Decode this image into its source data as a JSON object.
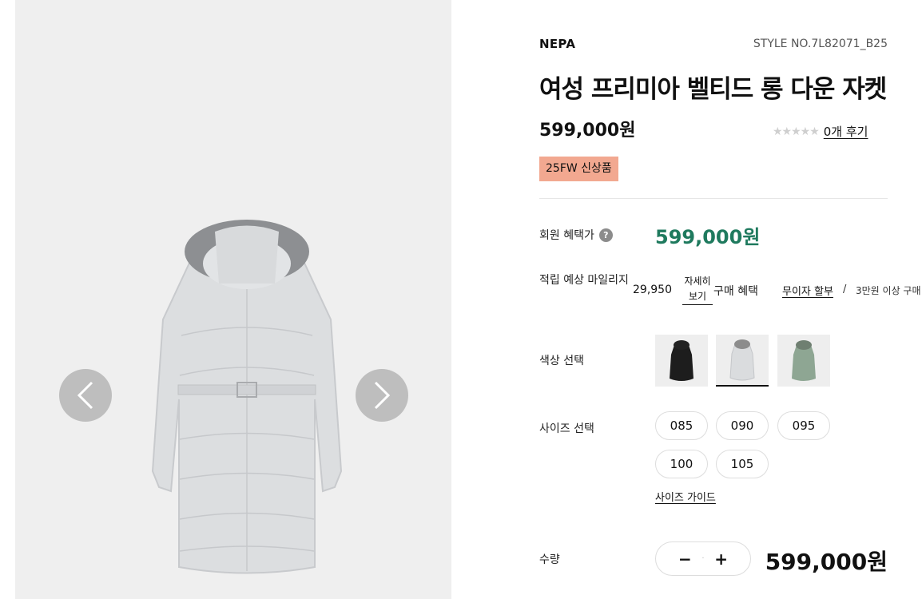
{
  "product": {
    "brand": "NEPA",
    "style_no": "STYLE NO.7L82071_B25",
    "title": "여성 프리미아 벨티드 롱 다운 자켓",
    "price": "599,000원",
    "rating": {
      "stars": "★★★★★",
      "filled": 0,
      "review_link": "0개 후기"
    },
    "badge": "25FW 신상품"
  },
  "benefits": {
    "member_label": "회원 혜택가",
    "help_icon": "?",
    "member_price": "599,000원",
    "mileage_label": "적립 예상 마일리지",
    "mileage_value": "29,950",
    "detail_link": "자세히 보기",
    "purchase_label": "구매 혜택",
    "interest_link": "무이자 할부",
    "separator": "/",
    "benefit_text": "3만원 이상 구매"
  },
  "options": {
    "color_label": "색상 선택",
    "colors": [
      {
        "name": "black-coat-swatch",
        "hex": "#1d1d1d",
        "fur": "#222"
      },
      {
        "name": "light-gray-coat-swatch",
        "hex": "#e6e6e6",
        "fur": "#8c8c8c",
        "selected": true
      },
      {
        "name": "sage-green-coat-swatch",
        "hex": "#8ea693",
        "fur": "#6f7f71"
      }
    ],
    "size_label": "사이즈 선택",
    "sizes": [
      "085",
      "090",
      "095",
      "100",
      "105"
    ],
    "size_guide": "사이즈 가이드"
  },
  "purchase": {
    "qty_label": "수량",
    "qty_minus": "−",
    "qty_value": "·",
    "qty_plus": "+",
    "total_price": "599,000원"
  },
  "colors": {
    "accent_green": "#1f7a5e",
    "badge_bg": "#f2a890",
    "gallery_bg": "#efefef"
  }
}
